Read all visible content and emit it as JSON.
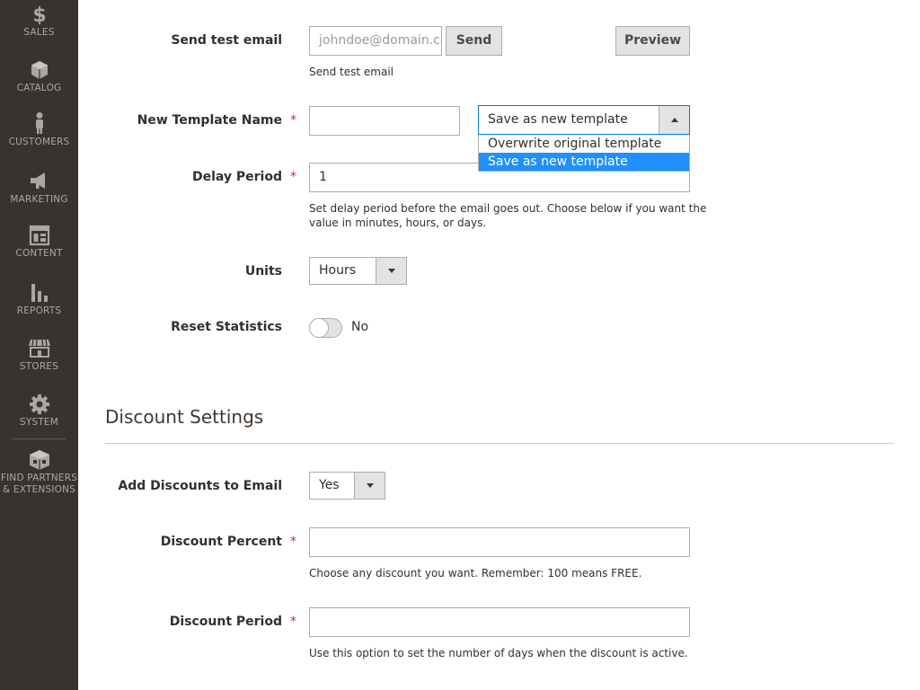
{
  "sidebar": {
    "items": [
      {
        "label": "SALES",
        "icon": "dollar-icon"
      },
      {
        "label": "CATALOG",
        "icon": "cube-icon"
      },
      {
        "label": "CUSTOMERS",
        "icon": "person-icon"
      },
      {
        "label": "MARKETING",
        "icon": "megaphone-icon"
      },
      {
        "label": "CONTENT",
        "icon": "layout-icon"
      },
      {
        "label": "REPORTS",
        "icon": "bar-chart-icon"
      },
      {
        "label": "STORES",
        "icon": "storefront-icon"
      },
      {
        "label": "SYSTEM",
        "icon": "gear-icon"
      },
      {
        "label_line1": "FIND PARTNERS",
        "label_line2": "& EXTENSIONS",
        "icon": "extensions-box-icon"
      }
    ]
  },
  "form": {
    "send_test_email": {
      "label": "Send test email",
      "placeholder": "johndoe@domain.com",
      "send_button": "Send",
      "preview_button": "Preview",
      "note": "Send test email"
    },
    "new_template_name": {
      "label": "New Template Name",
      "required_mark": "*",
      "value": "",
      "select": {
        "selected": "Save as new template",
        "options": [
          "Overwrite original template",
          "Save as new template"
        ],
        "expanded": true
      }
    },
    "delay_period": {
      "label": "Delay Period",
      "required_mark": "*",
      "value": "1",
      "note_line1": "Set delay period before the email goes out. Choose below if you want the",
      "note_line2": "value in minutes, hours, or days."
    },
    "units": {
      "label": "Units",
      "selected": "Hours"
    },
    "reset_statistics": {
      "label": "Reset Statistics",
      "state": "No"
    }
  },
  "discount": {
    "section_title": "Discount Settings",
    "add_discounts": {
      "label": "Add Discounts to Email",
      "selected": "Yes"
    },
    "discount_percent": {
      "label": "Discount Percent",
      "required_mark": "*",
      "value": "",
      "note": "Choose any discount you want. Remember: 100 means FREE."
    },
    "discount_period": {
      "label": "Discount Period",
      "required_mark": "*",
      "value": "",
      "note": "Use this option to set the number of days when the discount is active."
    }
  },
  "colors": {
    "sidebar_bg": "#373330",
    "sidebar_text": "#aaa6a0",
    "required": "#e22626",
    "option_selected": "#1e90ff",
    "focus_border": "#007bdb"
  }
}
